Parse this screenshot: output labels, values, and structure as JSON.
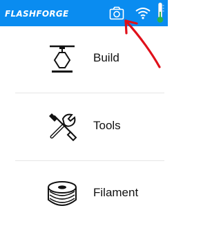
{
  "topbar": {
    "brand": "FLASHFORGE",
    "background": "#0a8cf0",
    "icons": [
      "camera-icon",
      "wifi-icon",
      "thermometer-icon"
    ]
  },
  "annotation": {
    "arrow_color": "#e0101a",
    "points_to": "camera-icon"
  },
  "menu": [
    {
      "label": "Build",
      "icon": "build-icon"
    },
    {
      "label": "Tools",
      "icon": "tools-icon"
    },
    {
      "label": "Filament",
      "icon": "filament-icon"
    }
  ]
}
